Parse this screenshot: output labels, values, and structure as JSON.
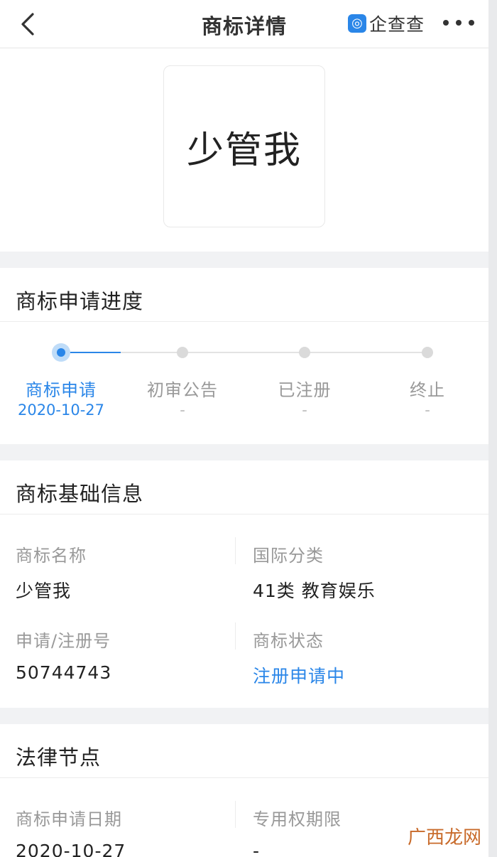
{
  "nav": {
    "title": "商标详情",
    "brand_logo_glyph": "◎",
    "brand_name": "企查查",
    "back_icon": "chevron-left-icon",
    "more_icon": "more-dots-icon"
  },
  "trademark_image": {
    "text": "少管我"
  },
  "progress": {
    "title": "商标申请进度",
    "steps": [
      {
        "label": "商标申请",
        "date": "2020-10-27",
        "active": true
      },
      {
        "label": "初审公告",
        "date": "-",
        "active": false
      },
      {
        "label": "已注册",
        "date": "-",
        "active": false
      },
      {
        "label": "终止",
        "date": "-",
        "active": false
      }
    ],
    "accent_color": "#2a86e8"
  },
  "basic_info": {
    "title": "商标基础信息",
    "fields": [
      {
        "label": "商标名称",
        "value": "少管我"
      },
      {
        "label": "国际分类",
        "value": "41类 教育娱乐"
      },
      {
        "label": "申请/注册号",
        "value": "50744743"
      },
      {
        "label": "商标状态",
        "value": "注册申请中"
      }
    ]
  },
  "legal": {
    "title": "法律节点",
    "fields": [
      {
        "label": "商标申请日期",
        "value": "2020-10-27"
      },
      {
        "label": "专用权期限",
        "value": "-"
      }
    ]
  },
  "watermark": {
    "text": "广西龙网"
  }
}
